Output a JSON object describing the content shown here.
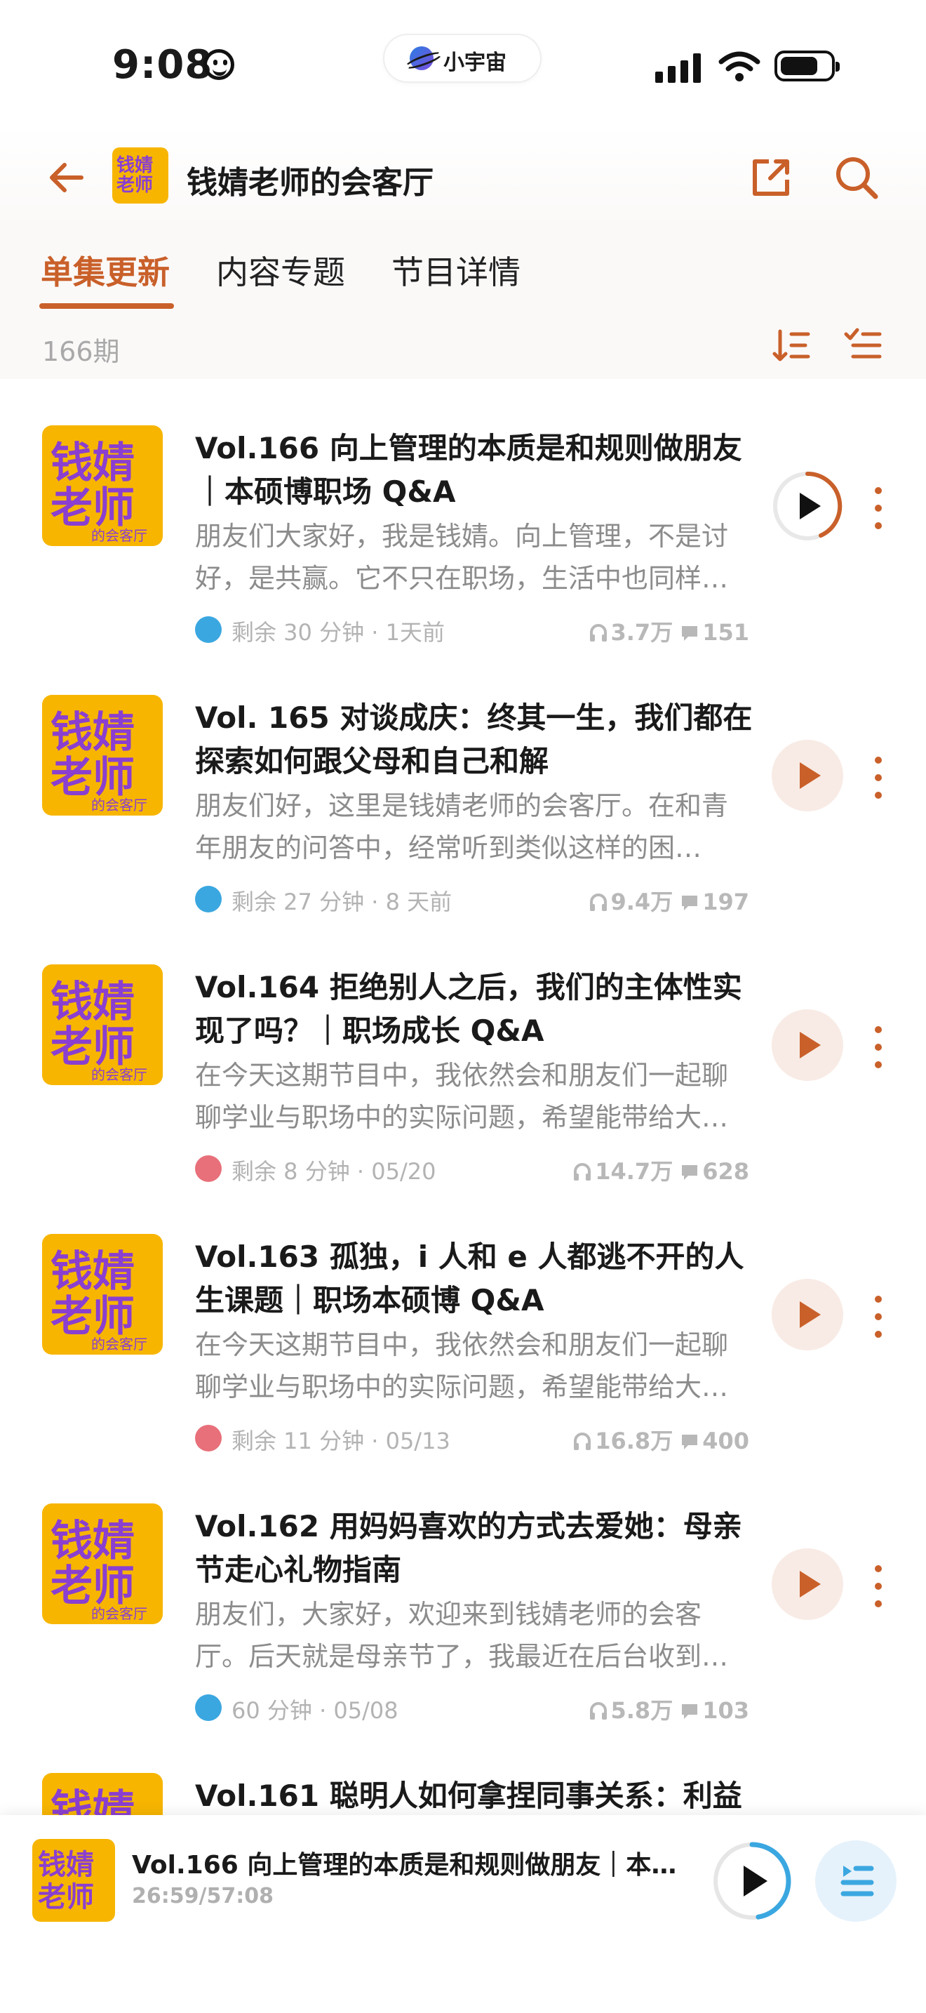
{
  "status_bar": {
    "time": "9:08",
    "island_label": "小宇宙"
  },
  "header": {
    "title": "钱婧老师的会客厅",
    "cover_text_1": "钱婧",
    "cover_text_2": "老师",
    "cover_text_3": "的会客厅"
  },
  "tabs": [
    {
      "label": "单集更新",
      "active": true
    },
    {
      "label": "内容专题",
      "active": false
    },
    {
      "label": "节目详情",
      "active": false
    }
  ],
  "episode_count": "166期",
  "episodes": [
    {
      "title": "Vol.166 向上管理的本质是和规则做朋友｜本硕博职场 Q&A",
      "desc": "朋友们大家好，我是钱婧。向上管理，不是讨好，是共赢。它不只在职场，生活中也同样…",
      "meta": "剩余 30 分钟 · 1天前",
      "plays": "3.7万",
      "comments": "151",
      "status": "in-progress",
      "playing": true
    },
    {
      "title": "Vol. 165 对谈成庆：终其一生，我们都在探索如何跟父母和自己和解",
      "desc": "朋友们好，这里是钱婧老师的会客厅。在和青年朋友的问答中，经常听到类似这样的困…",
      "meta": "剩余 27 分钟 · 8 天前",
      "plays": "9.4万",
      "comments": "197",
      "status": "in-progress",
      "playing": false
    },
    {
      "title": "Vol.164 拒绝别人之后，我们的主体性实现了吗？｜职场成长 Q&A",
      "desc": "在今天这期节目中，我依然会和朋友们一起聊聊学业与职场中的实际问题，希望能带给大…",
      "meta": "剩余 8 分钟 · 05/20",
      "plays": "14.7万",
      "comments": "628",
      "status": "played",
      "playing": false
    },
    {
      "title": "Vol.163 孤独，i 人和 e 人都逃不开的人生课题｜职场本硕博 Q&A",
      "desc": "在今天这期节目中，我依然会和朋友们一起聊聊学业与职场中的实际问题，希望能带给大…",
      "meta": "剩余 11 分钟 · 05/13",
      "plays": "16.8万",
      "comments": "400",
      "status": "played",
      "playing": false
    },
    {
      "title": "Vol.162 用妈妈喜欢的方式去爱她：母亲节走心礼物指南",
      "desc": "朋友们，大家好，欢迎来到钱婧老师的会客厅。后天就是母亲节了，我最近在后台收到…",
      "meta": "60 分钟 · 05/08",
      "plays": "5.8万",
      "comments": "103",
      "status": "in-progress",
      "playing": false
    },
    {
      "title": "Vol.161 聪明人如何拿捏同事关系：利益",
      "desc": "",
      "meta": "",
      "plays": "",
      "comments": "",
      "status": "in-progress",
      "playing": false
    }
  ],
  "player": {
    "title": "Vol.166 向上管理的本质是和规则做朋友｜本…",
    "time": "26:59/57:08",
    "progress": 0.472
  },
  "colors": {
    "accent": "#c9602a",
    "cover_bg": "#f7b500",
    "cover_text": "#8a3fd0",
    "blue": "#3ba7e0"
  }
}
